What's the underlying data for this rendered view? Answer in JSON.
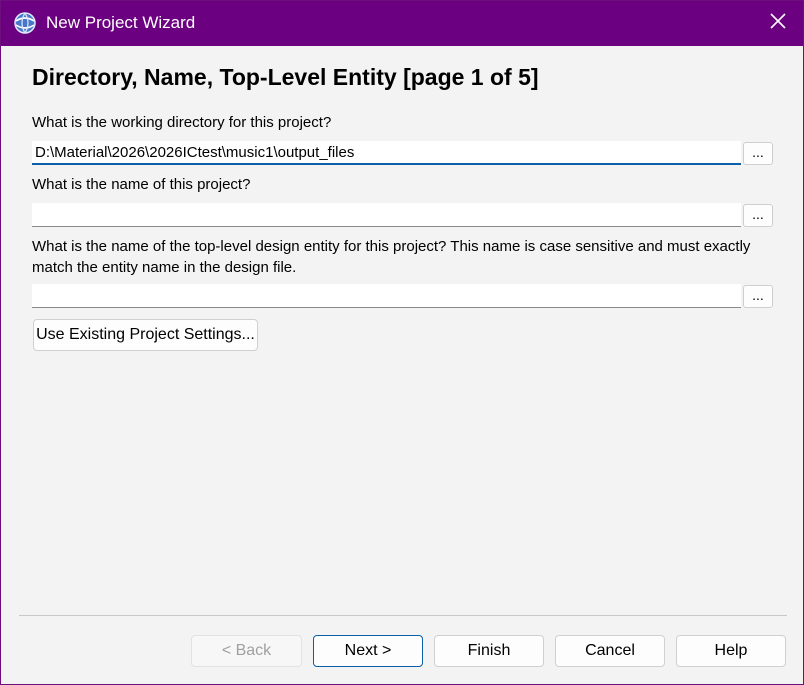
{
  "window": {
    "title": "New Project Wizard",
    "app_icon": "quartus-globe-icon",
    "close_icon": "close-icon"
  },
  "page": {
    "heading": "Directory, Name, Top-Level Entity [page 1 of 5]",
    "working_dir_label": "What is the working directory for this project?",
    "working_dir_value": "D:\\Material\\2026\\2026ICtest\\music1\\output_files",
    "project_name_label": "What is the name of this project?",
    "project_name_value": "",
    "top_entity_label": "What is the name of the top-level design entity for this project? This name is case sensitive and must exactly match the entity name in the design file.",
    "top_entity_value": "",
    "browse_label": "...",
    "use_existing_label": "Use Existing Project Settings..."
  },
  "footer": {
    "back_label": "< Back",
    "next_label": "Next >",
    "finish_label": "Finish",
    "cancel_label": "Cancel",
    "help_label": "Help"
  },
  "colors": {
    "titlebar": "#6b0080",
    "focus_accent": "#0a5fa8",
    "background": "#f3f3f3"
  }
}
